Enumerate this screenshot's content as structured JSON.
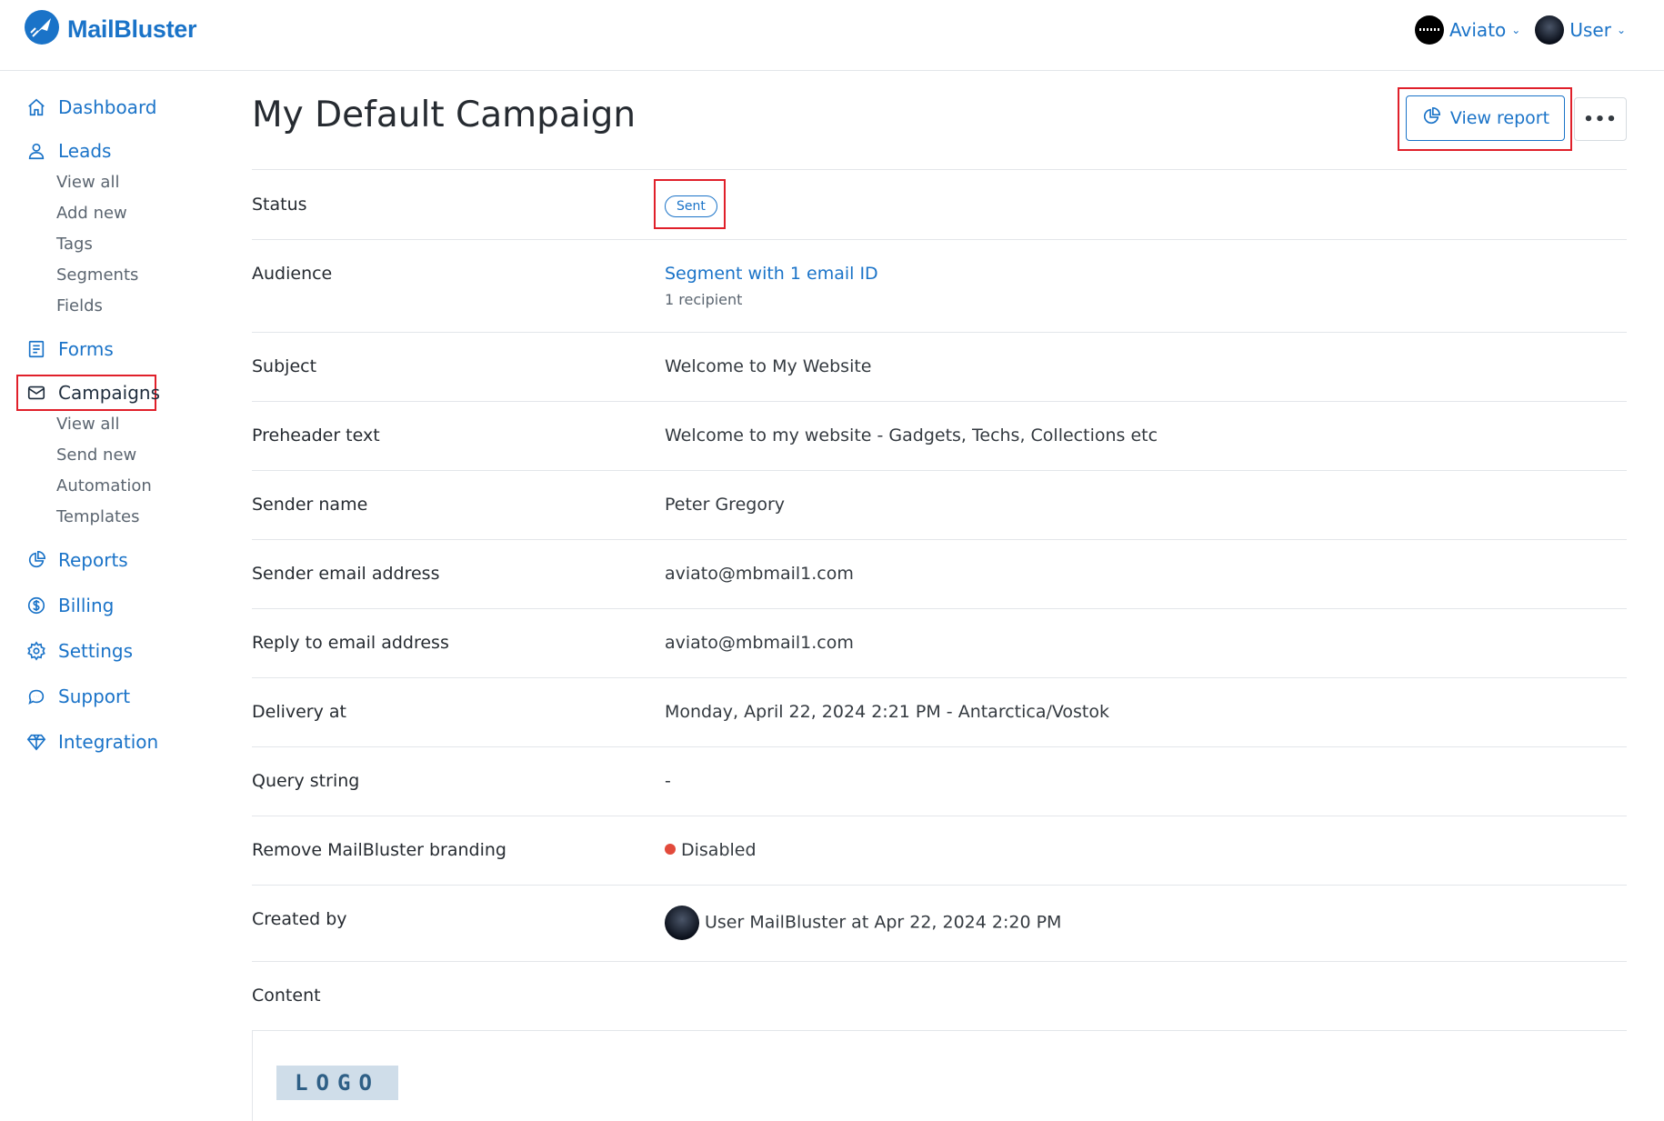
{
  "header": {
    "brand": "MailBluster",
    "account_menu": "Aviato",
    "user_menu": "User"
  },
  "sidebar": {
    "items": [
      {
        "label": "Dashboard",
        "icon": "home-icon"
      },
      {
        "label": "Leads",
        "icon": "user-icon",
        "children": [
          "View all",
          "Add new",
          "Tags",
          "Segments",
          "Fields"
        ]
      },
      {
        "label": "Forms",
        "icon": "form-icon"
      },
      {
        "label": "Campaigns",
        "icon": "envelope-icon",
        "active": true,
        "children": [
          "View all",
          "Send new",
          "Automation",
          "Templates"
        ]
      },
      {
        "label": "Reports",
        "icon": "pie-chart-icon"
      },
      {
        "label": "Billing",
        "icon": "dollar-icon"
      },
      {
        "label": "Settings",
        "icon": "gear-icon"
      },
      {
        "label": "Support",
        "icon": "chat-icon"
      },
      {
        "label": "Integration",
        "icon": "diamond-icon"
      }
    ]
  },
  "page": {
    "title": "My Default Campaign",
    "view_report_label": "View report",
    "more_label": "•••"
  },
  "details": {
    "status": {
      "label": "Status",
      "value": "Sent"
    },
    "audience": {
      "label": "Audience",
      "value": "Segment with 1 email ID",
      "sub": "1 recipient"
    },
    "subject": {
      "label": "Subject",
      "value": "Welcome to My Website"
    },
    "preheader": {
      "label": "Preheader text",
      "value": "Welcome to my website - Gadgets, Techs, Collections etc"
    },
    "sender_name": {
      "label": "Sender name",
      "value": "Peter Gregory"
    },
    "sender_email": {
      "label": "Sender email address",
      "value": "aviato@mbmail1.com"
    },
    "reply_email": {
      "label": "Reply to email address",
      "value": "aviato@mbmail1.com"
    },
    "delivery": {
      "label": "Delivery at",
      "value": "Monday, April 22, 2024 2:21 PM - Antarctica/Vostok"
    },
    "query": {
      "label": "Query string",
      "value": "-"
    },
    "branding": {
      "label": "Remove MailBluster branding",
      "value": "Disabled"
    },
    "created_by": {
      "label": "Created by",
      "value": "User MailBluster at Apr 22, 2024 2:20 PM"
    },
    "content": {
      "label": "Content",
      "logo_text": "LOGO"
    }
  },
  "colors": {
    "accent": "#1a73c8",
    "highlight": "#e0202a",
    "disabled_dot": "#e24a3b"
  }
}
